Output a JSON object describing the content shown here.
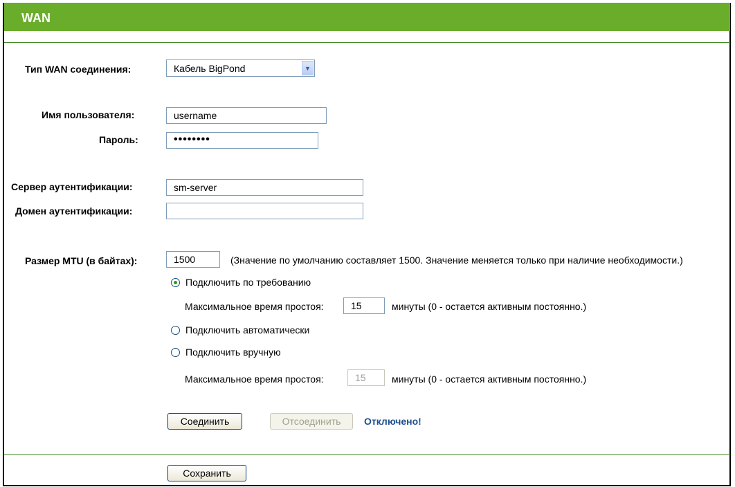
{
  "header": {
    "title": "WAN"
  },
  "form": {
    "wan_type": {
      "label": "Тип WAN соединения:",
      "value": "Кабель BigPond"
    },
    "username": {
      "label": "Имя пользователя:",
      "value": "username"
    },
    "password": {
      "label": "Пароль:",
      "value": "••••••••"
    },
    "auth_server": {
      "label": "Сервер аутентификации:",
      "value": "sm-server"
    },
    "auth_domain": {
      "label": "Домен аутентификации:",
      "value": ""
    },
    "mtu": {
      "label": "Размер MTU (в байтах):",
      "value": "1500",
      "hint": "(Значение по умолчанию составляет 1500. Значение меняется только при наличие необходимости.)"
    },
    "modes": {
      "on_demand": {
        "label": "Подключить по требованию",
        "checked": true
      },
      "idle_on_demand": {
        "label": "Максимальное время простоя:",
        "value": "15",
        "suffix": "минуты (0 - остается активным постоянно.)"
      },
      "auto": {
        "label": "Подключить автоматически",
        "checked": false
      },
      "manual": {
        "label": "Подключить вручную",
        "checked": false
      },
      "idle_manual": {
        "label": "Максимальное время простоя:",
        "value": "15",
        "suffix": "минуты (0 - остается активным постоянно.)"
      }
    },
    "connect_label": "Соединить",
    "disconnect_label": "Отсоединить",
    "status": "Отключено!",
    "save_label": "Сохранить"
  },
  "colors": {
    "header": "#6aad2a",
    "separator": "#3e8a1e",
    "status": "#1f4f8f",
    "radio_dot": "#21a121"
  }
}
